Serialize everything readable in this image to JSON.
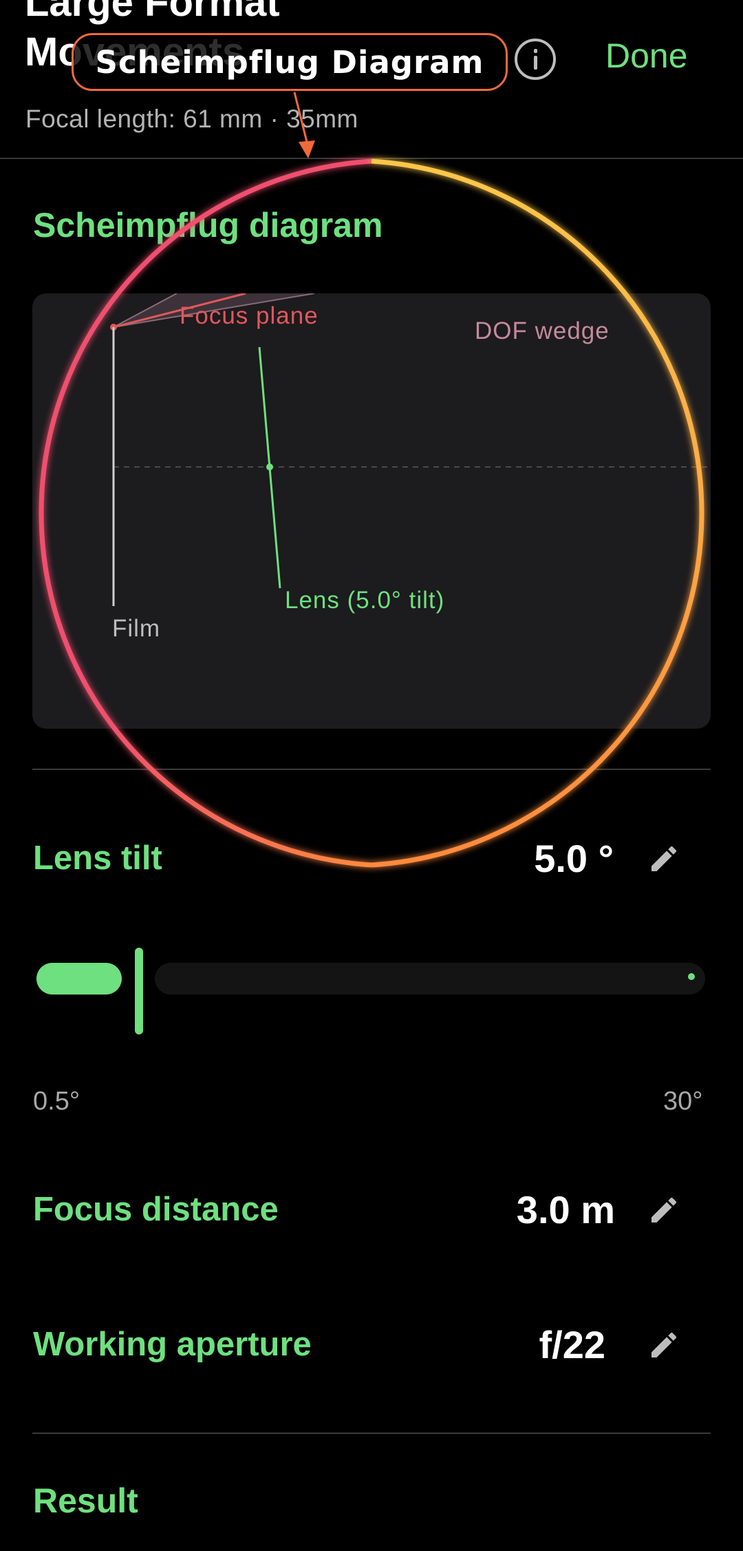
{
  "header": {
    "title": "Large Format Movements",
    "subtitle": "Focal length: 61 mm · 35mm",
    "done_label": "Done",
    "info_icon": "info-icon"
  },
  "diagram_section": {
    "heading": "Scheimpflug diagram",
    "labels": {
      "focus_plane": "Focus plane",
      "dof_wedge": "DOF wedge",
      "lens": "Lens (5.0° tilt)",
      "film": "Film"
    }
  },
  "lens_tilt": {
    "label": "Lens tilt",
    "value": "5.0 °",
    "slider": {
      "min_label": "0.5°",
      "max_label": "30°",
      "min": 0.5,
      "max": 30,
      "current": 5.0
    }
  },
  "focus_distance": {
    "label": "Focus distance",
    "value": "3.0 m"
  },
  "working_aperture": {
    "label": "Working aperture",
    "value": "f/22"
  },
  "result": {
    "heading": "Result"
  },
  "annotation": {
    "callout_label": "Scheimpflug Diagram",
    "colors": {
      "ring_start": "#f0506e",
      "ring_mid": "#fbc74a",
      "ring_end": "#ff8a3d",
      "callout_border": "#f26a3a"
    }
  },
  "colors": {
    "accent": "#6ee07f",
    "focus_plane": "#e0585c",
    "dof": "#c48a9a",
    "card": "#1c1b1e",
    "background": "#000000"
  }
}
